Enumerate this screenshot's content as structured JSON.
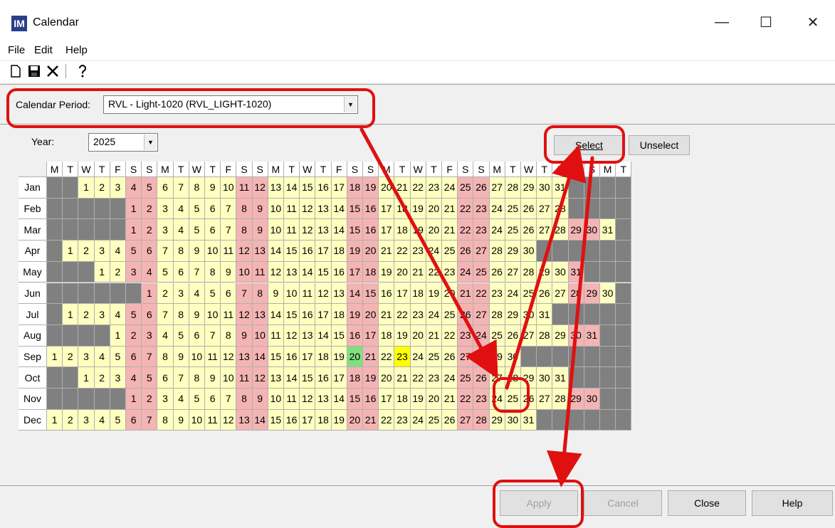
{
  "window": {
    "title": "Calendar",
    "icon_label": "IM",
    "controls": [
      "—",
      "☐",
      "✕"
    ]
  },
  "menu": [
    "File",
    "Edit",
    "Help"
  ],
  "toolbar": {
    "icons": [
      "new-icon",
      "save-icon",
      "delete-icon",
      "help-icon"
    ]
  },
  "calendar_period": {
    "label": "Calendar Period:",
    "value": "RVL - Light-1020 (RVL_LIGHT-1020)"
  },
  "year": {
    "label": "Year:",
    "value": "2025"
  },
  "buttons": {
    "select": "Select",
    "unselect": "Unselect",
    "apply": "Apply",
    "cancel": "Cancel",
    "close": "Close",
    "help": "Help"
  },
  "grid": {
    "day_headers": [
      "M",
      "T",
      "W",
      "T",
      "F",
      "S",
      "S",
      "M",
      "T",
      "W",
      "T",
      "F",
      "S",
      "S",
      "M",
      "T",
      "W",
      "T",
      "F",
      "S",
      "S",
      "M",
      "T",
      "W",
      "T",
      "F",
      "S",
      "S",
      "M",
      "T",
      "W",
      "T",
      "F",
      "S",
      "S",
      "M",
      "T"
    ],
    "months": [
      {
        "name": "Jan",
        "offset": 2,
        "days": 31
      },
      {
        "name": "Feb",
        "offset": 5,
        "days": 28
      },
      {
        "name": "Mar",
        "offset": 5,
        "days": 31
      },
      {
        "name": "Apr",
        "offset": 1,
        "days": 30
      },
      {
        "name": "May",
        "offset": 3,
        "days": 31
      },
      {
        "name": "Jun",
        "offset": 6,
        "days": 30
      },
      {
        "name": "Jul",
        "offset": 1,
        "days": 31
      },
      {
        "name": "Aug",
        "offset": 4,
        "days": 31
      },
      {
        "name": "Sep",
        "offset": 0,
        "days": 30
      },
      {
        "name": "Oct",
        "offset": 2,
        "days": 31
      },
      {
        "name": "Nov",
        "offset": 5,
        "days": 30
      },
      {
        "name": "Dec",
        "offset": 0,
        "days": 31
      }
    ],
    "highlights": [
      {
        "month": "Sep",
        "day": 20,
        "color": "#80e080"
      },
      {
        "month": "Sep",
        "day": 23,
        "color": "#ffff00"
      }
    ],
    "colors": {
      "weekday": "#ffffc0",
      "weekend": "#f4b4b4",
      "blank": "#808080",
      "header": "#ffffff"
    }
  },
  "annotations": {
    "color": "#e01010"
  }
}
